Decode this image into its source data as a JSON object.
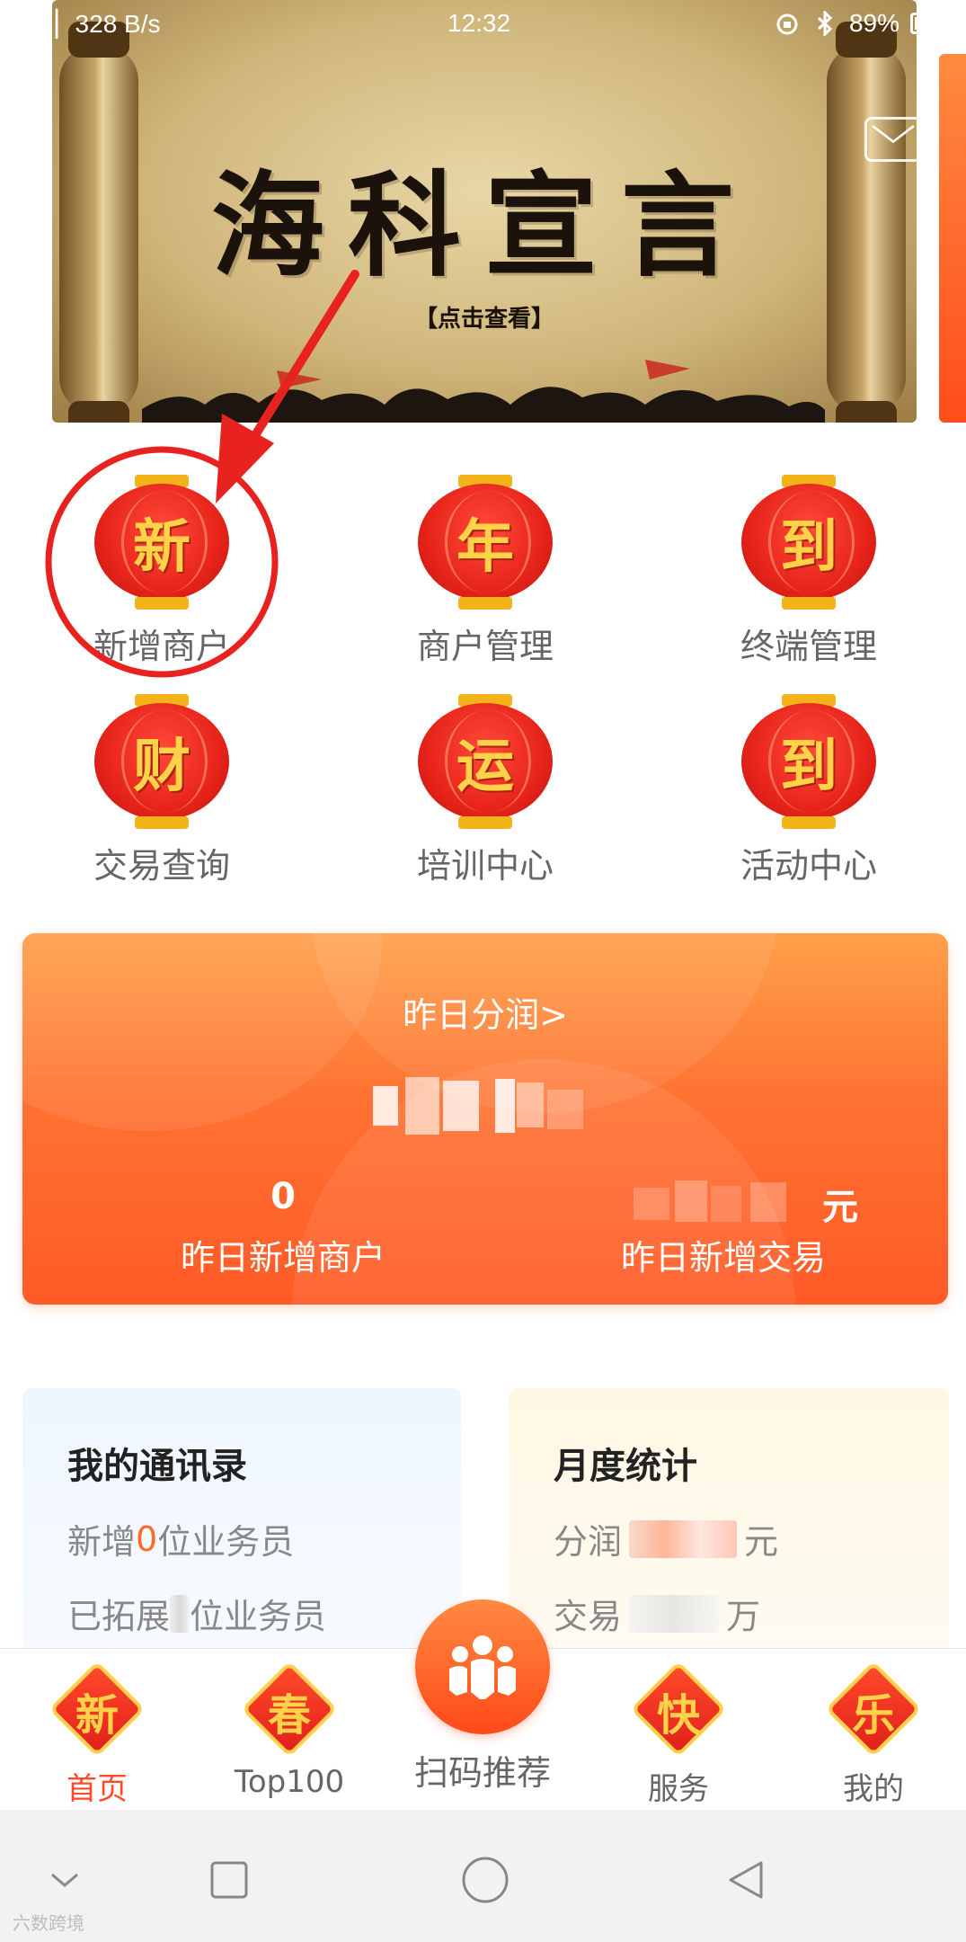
{
  "status_bar": {
    "network_speed": "328 B/s",
    "time": "12:32",
    "battery": "89%",
    "battery_level": 0.89
  },
  "banner": {
    "title": "海科宣言",
    "subtitle": "【点击查看】"
  },
  "grid": {
    "items": [
      {
        "glyph": "新",
        "label": "新增商户"
      },
      {
        "glyph": "年",
        "label": "商户管理"
      },
      {
        "glyph": "到",
        "label": "终端管理"
      },
      {
        "glyph": "财",
        "label": "交易查询"
      },
      {
        "glyph": "运",
        "label": "培训中心"
      },
      {
        "glyph": "到",
        "label": "活动中心"
      }
    ]
  },
  "profit_card": {
    "title": "昨日分润>",
    "new_merchants_value": "0",
    "new_merchants_label": "昨日新增商户",
    "new_transactions_unit": "元",
    "new_transactions_label": "昨日新增交易"
  },
  "contacts_card": {
    "title": "我的通讯录",
    "row1_prefix": "新增",
    "row1_value": "0",
    "row1_suffix": "位业务员",
    "row2_prefix": "已拓展",
    "row2_suffix": "位业务员"
  },
  "monthly_card": {
    "title": "月度统计",
    "row1_label": "分润",
    "row1_unit": "元",
    "row2_label": "交易",
    "row2_unit": "万"
  },
  "tab_bar": {
    "tabs": [
      {
        "glyph": "新",
        "label": "首页"
      },
      {
        "glyph": "春",
        "label": "Top100"
      },
      {
        "label": "扫码推荐"
      },
      {
        "glyph": "快",
        "label": "服务"
      },
      {
        "glyph": "乐",
        "label": "我的"
      }
    ]
  },
  "watermark": "六数跨境",
  "colors": {
    "accent": "#ff4a2a",
    "card_orange": "#ff7232",
    "lantern_red": "#e7241a",
    "gold": "#ffd24a"
  }
}
